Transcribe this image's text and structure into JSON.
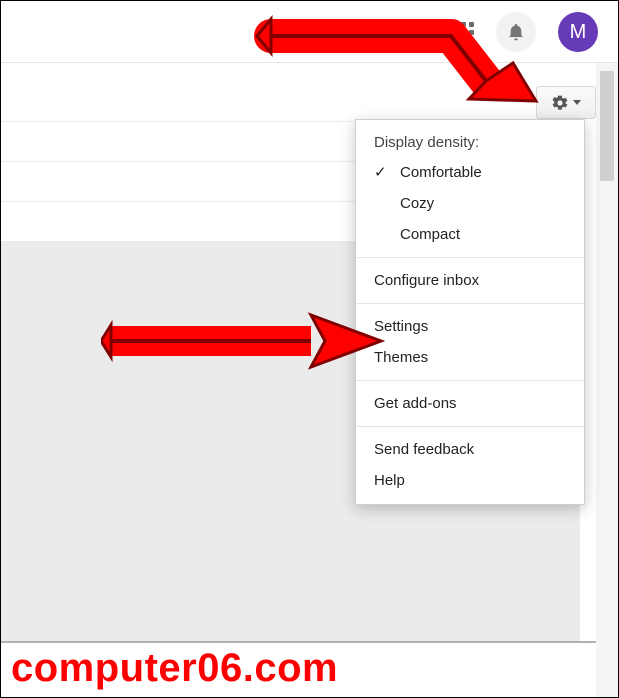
{
  "header": {
    "avatar_initial": "M"
  },
  "menu": {
    "section_label": "Display density:",
    "density_comfortable": "Comfortable",
    "density_cozy": "Cozy",
    "density_compact": "Compact",
    "configure_inbox": "Configure inbox",
    "settings": "Settings",
    "themes": "Themes",
    "get_addons": "Get add-ons",
    "send_feedback": "Send feedback",
    "help": "Help"
  },
  "watermark": "computer06.com"
}
